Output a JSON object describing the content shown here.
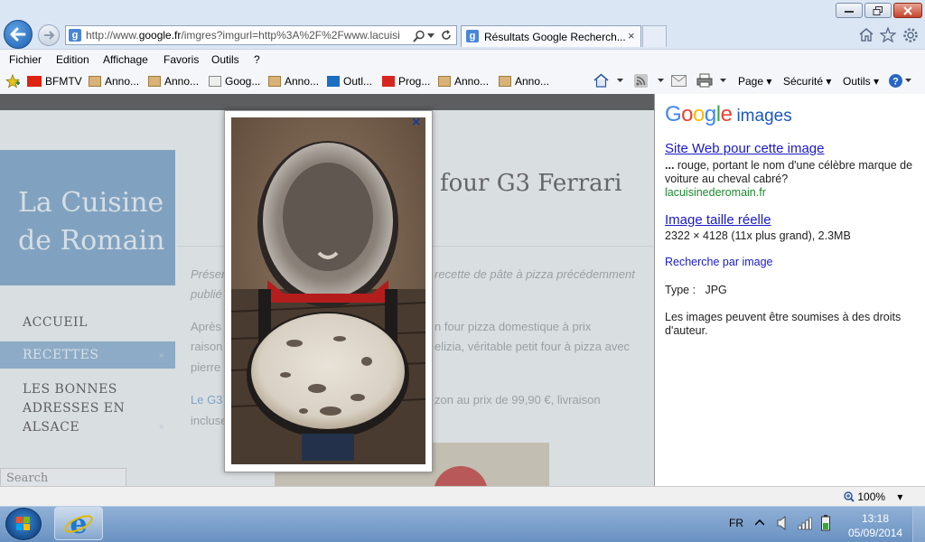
{
  "browser": {
    "address_url_prefix": "http://www.",
    "address_url_domain": "google.fr",
    "address_url_rest": "/imgres?imgurl=http%3A%2F%2Fwww.lacuisi",
    "tab_title": "Résultats Google Recherch...",
    "tab_close": "×",
    "favicon_letter": "g"
  },
  "menu": [
    "Fichier",
    "Edition",
    "Affichage",
    "Favoris",
    "Outils",
    "?"
  ],
  "favorites": [
    {
      "label": "BFMTV",
      "icon": "bfmtv-icon"
    },
    {
      "label": "Anno...",
      "icon": "package-icon"
    },
    {
      "label": "Anno...",
      "icon": "package-icon"
    },
    {
      "label": "Goog...",
      "icon": "news-icon"
    },
    {
      "label": "Anno...",
      "icon": "package-icon"
    },
    {
      "label": "Outl...",
      "icon": "outlook-icon"
    },
    {
      "label": "Prog...",
      "icon": "telerama-icon"
    },
    {
      "label": "Anno...",
      "icon": "package-icon"
    },
    {
      "label": "Anno...",
      "icon": "package-icon"
    }
  ],
  "command_bar": {
    "page": "Page",
    "security": "Sécurité",
    "tools": "Outils"
  },
  "page": {
    "site_title": "La Cuisine de Romain",
    "post_title": "four G3 Ferrari",
    "nav": [
      "ACCUEIL",
      "RECETTES",
      "LES BONNES ADRESSES EN ALSACE"
    ],
    "intro_line1_left": "Présen",
    "intro_line1_right": "recette de pâte à pizza précédemment",
    "intro_line2": "publié",
    "p1_line1_left": "Après",
    "p1_line1_right": "n four pizza domestique à prix",
    "p1_line2_left": "raison",
    "p1_line2_right": "elizia, véritable petit four à pizza avec",
    "p1_line3": "pierre",
    "p2_line1_left": "Le G3",
    "p2_line1_right": "zon au prix de 99,90 €, livraison",
    "p2_line2": "incluse",
    "search_placeholder": "Search"
  },
  "popup": {
    "close_label": "×"
  },
  "google_panel": {
    "logo": "Google",
    "logo_sub": "images",
    "site_link": "Site Web pour cette image",
    "snippet_bold": "...",
    "snippet": " rouge, portant le nom d'une célèbre marque de voiture au cheval cabré?",
    "site_domain": "lacuisinederomain.fr",
    "full_size_link": "Image taille réelle",
    "dimensions": "2322 × 4128 (11x plus grand), 2.3MB",
    "search_by_image": "Recherche par image",
    "type_label": "Type :",
    "type_value": "JPG",
    "rights_notice": "Les images peuvent être soumises à des droits d'auteur."
  },
  "status": {
    "zoom": "100%"
  },
  "taskbar": {
    "language": "FR",
    "time": "13:18",
    "date": "05/09/2014"
  },
  "colors": {
    "google_blue": "#4285f4",
    "google_red": "#ea4335",
    "google_yellow": "#fbbc05",
    "google_green": "#34a853",
    "link": "#1a1ac8",
    "sidebar_blue": "#6c99c1"
  }
}
